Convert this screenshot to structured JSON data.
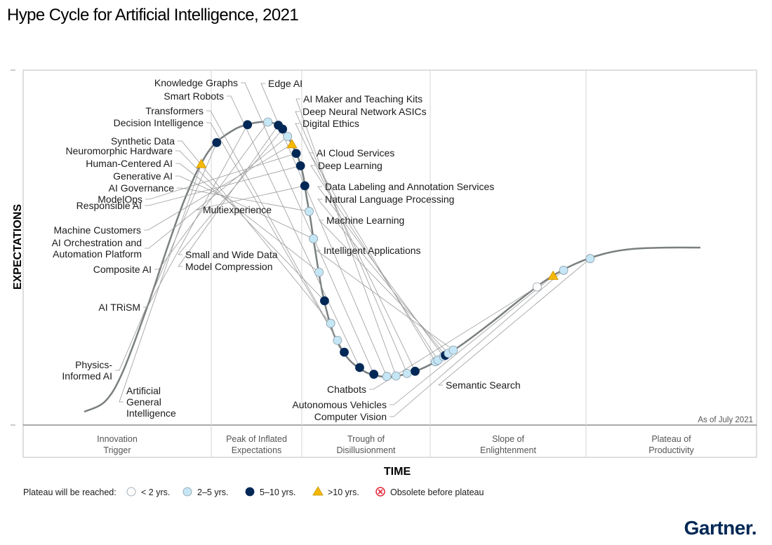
{
  "title": "Hype Cycle for Artificial Intelligence, 2021",
  "brand": "Gartner.",
  "chart_data": {
    "type": "scatter",
    "title": "Hype Cycle for Artificial Intelligence, 2021",
    "xlabel": "TIME",
    "ylabel": "EXPECTATIONS",
    "as_of": "As of July 2021",
    "phases": [
      {
        "lines": [
          "Innovation",
          "Trigger"
        ]
      },
      {
        "lines": [
          "Peak of Inflated",
          "Expectations"
        ]
      },
      {
        "lines": [
          "Trough of",
          "Disillusionment"
        ]
      },
      {
        "lines": [
          "Slope of",
          "Enlightenment"
        ]
      },
      {
        "lines": [
          "Plateau of",
          "Productivity"
        ]
      }
    ],
    "legend": {
      "title": "Plateau will be reached:",
      "items": [
        {
          "key": "lt2",
          "label": "< 2 yrs."
        },
        {
          "key": "2to5",
          "label": "2–5 yrs."
        },
        {
          "key": "5to10",
          "label": "5–10 yrs."
        },
        {
          "key": "gt10",
          "label": ">10 yrs."
        },
        {
          "key": "obsolete",
          "label": "Obsolete before plateau"
        }
      ]
    },
    "colors": {
      "lt2": "#ffffff",
      "2to5": "#c5e6f5",
      "5to10": "#002856",
      "gt10": "#f5b800",
      "obsolete": "#e0283a",
      "curve": "#7a7f80"
    },
    "points": [
      {
        "lines": [
          "Artificial",
          "General",
          "Intelligence"
        ],
        "t": 0.19,
        "cat": "gt10"
      },
      {
        "lines": [
          "Physics-",
          "Informed AI"
        ],
        "t": 0.215,
        "cat": "5to10"
      },
      {
        "lines": [
          "AI TRiSM"
        ],
        "t": 0.265,
        "cat": "5to10"
      },
      {
        "lines": [
          "Composite AI"
        ],
        "t": 0.298,
        "cat": "2to5"
      },
      {
        "lines": [
          "Model Compression"
        ],
        "t": 0.315,
        "cat": "5to10"
      },
      {
        "lines": [
          "Small and Wide Data"
        ],
        "t": 0.322,
        "cat": "5to10"
      },
      {
        "lines": [
          "AI Orchestration and",
          "Automation Platform"
        ],
        "t": 0.33,
        "cat": "2to5"
      },
      {
        "lines": [
          "Machine Customers"
        ],
        "t": 0.337,
        "cat": "gt10"
      },
      {
        "lines": [
          "ModelOps"
        ],
        "t": 0.344,
        "cat": "5to10"
      },
      {
        "lines": [
          "Responsible AI"
        ],
        "t": 0.351,
        "cat": "5to10"
      },
      {
        "lines": [
          "Multiexperience"
        ],
        "t": 0.358,
        "cat": "5to10"
      },
      {
        "lines": [
          "AI Governance"
        ],
        "t": 0.365,
        "cat": "2to5"
      },
      {
        "lines": [
          "Generative AI"
        ],
        "t": 0.372,
        "cat": "2to5"
      },
      {
        "lines": [
          "Human-Centered AI"
        ],
        "t": 0.381,
        "cat": "2to5"
      },
      {
        "lines": [
          "Neuromorphic Hardware"
        ],
        "t": 0.39,
        "cat": "5to10"
      },
      {
        "lines": [
          "Synthetic Data"
        ],
        "t": 0.4,
        "cat": "2to5"
      },
      {
        "lines": [
          "Transformers"
        ],
        "t": 0.411,
        "cat": "2to5"
      },
      {
        "lines": [
          "Decision Intelligence"
        ],
        "t": 0.422,
        "cat": "5to10"
      },
      {
        "lines": [
          "Smart Robots"
        ],
        "t": 0.447,
        "cat": "5to10"
      },
      {
        "lines": [
          "Knowledge Graphs"
        ],
        "t": 0.47,
        "cat": "5to10"
      },
      {
        "lines": [
          "Edge AI"
        ],
        "t": 0.491,
        "cat": "2to5"
      },
      {
        "lines": [
          "AI Maker and Teaching Kits"
        ],
        "t": 0.506,
        "cat": "2to5"
      },
      {
        "lines": [
          "Deep Neural Network ASICs"
        ],
        "t": 0.524,
        "cat": "2to5"
      },
      {
        "lines": [
          "Digital Ethics"
        ],
        "t": 0.537,
        "cat": "5to10"
      },
      {
        "lines": [
          "AI Cloud Services"
        ],
        "t": 0.57,
        "cat": "2to5"
      },
      {
        "lines": [
          "Deep Learning"
        ],
        "t": 0.574,
        "cat": "2to5"
      },
      {
        "lines": [
          "Data Labeling and Annotation Services"
        ],
        "t": 0.583,
        "cat": "2to5"
      },
      {
        "lines": [
          "Natural Language Processing"
        ],
        "t": 0.586,
        "cat": "5to10"
      },
      {
        "lines": [
          "Machine Learning"
        ],
        "t": 0.591,
        "cat": "2to5"
      },
      {
        "lines": [
          "Intelligent Applications"
        ],
        "t": 0.599,
        "cat": "2to5"
      },
      {
        "lines": [
          "Chatbots"
        ],
        "t": 0.735,
        "cat": "lt2"
      },
      {
        "lines": [
          "Autonomous Vehicles"
        ],
        "t": 0.761,
        "cat": "gt10"
      },
      {
        "lines": [
          "Computer Vision"
        ],
        "t": 0.778,
        "cat": "2to5"
      },
      {
        "lines": [
          "Semantic Search"
        ],
        "t": 0.821,
        "cat": "2to5"
      }
    ]
  }
}
